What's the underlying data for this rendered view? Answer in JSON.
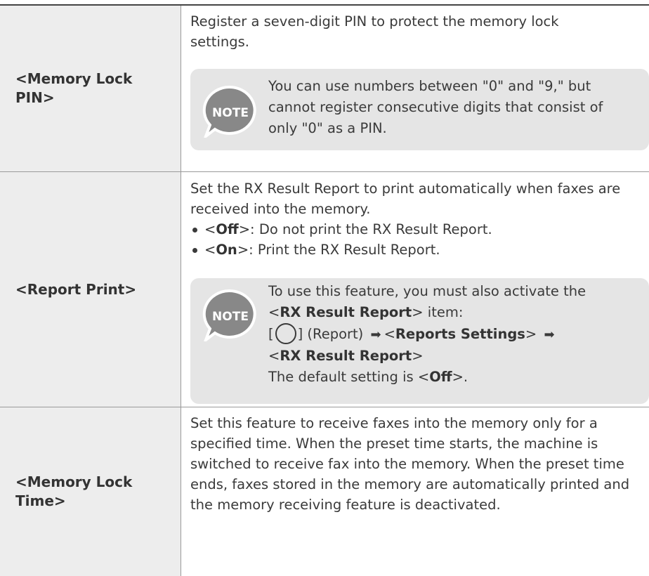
{
  "rows": [
    {
      "label": "<Memory Lock PIN>",
      "text": "Register a seven-digit PIN to protect the memory lock settings.",
      "note_label": "NOTE",
      "note_text": "You can use numbers between \"0\" and \"9,\" but cannot register consecutive digits that consist of only \"0\" as a PIN."
    },
    {
      "label": "<Report Print>",
      "text": "Set the RX Result Report to print automatically when faxes are received into the memory.",
      "bullets": [
        {
          "pre": "<",
          "bold": "Off",
          "post": ">: Do not print the RX Result Report."
        },
        {
          "pre": "<",
          "bold": "On",
          "post": ">: Print the RX Result Report."
        }
      ],
      "note_label": "NOTE",
      "note": {
        "line1_pre": "To use this feature, you must also activate the",
        "line2_pre": "<",
        "line2_bold": "RX Result Report",
        "line2_post": "> item:",
        "line3_open": "[",
        "line3_close": "] (Report)",
        "line3_lt": "<",
        "line3_bold": "Reports Settings",
        "line3_gt": ">",
        "line4_pre": "<",
        "line4_bold": "RX Result Report",
        "line4_post": ">",
        "line5_pre": "The default setting is <",
        "line5_bold": "Off",
        "line5_post": ">."
      }
    },
    {
      "label": "<Memory Lock Time>",
      "text": "Set this feature to receive faxes into the memory only for a specified time. When the preset time starts, the machine is switched to receive fax into the memory. When the preset time ends, faxes stored in the memory are automatically printed and the memory receiving feature is deactivated."
    }
  ],
  "colors": {
    "label_bg": "#ededed",
    "note_bg": "#e5e5e5",
    "note_icon": "#888888"
  }
}
